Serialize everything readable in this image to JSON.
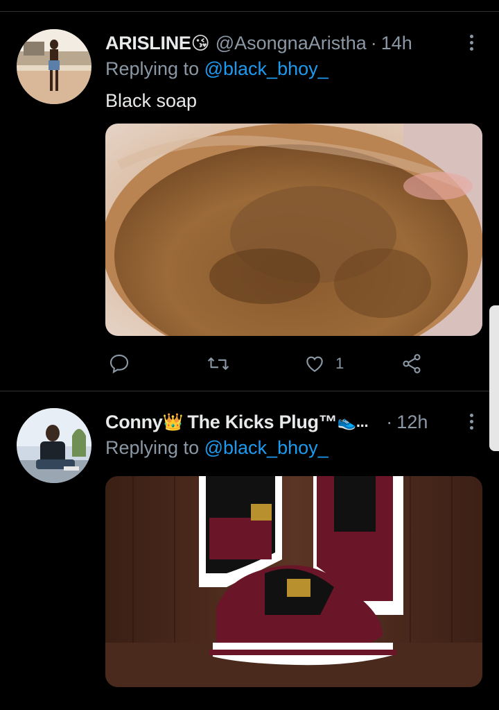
{
  "tweets": [
    {
      "name": "ARISLINE",
      "name_emoji": "😘",
      "handle": "@AsongnaAristha",
      "separator": "·",
      "time": "14h",
      "replying_prefix": "Replying to",
      "replying_handle": "@black_bhoy_",
      "text": "Black soap",
      "media_description": "jar of brown black soap",
      "likes": "1",
      "icons": [
        "reply-icon",
        "retweet-icon",
        "like-icon",
        "share-icon",
        "more-icon"
      ]
    },
    {
      "name": "Conny",
      "name_emoji": "👑",
      "name_suffix": "The Kicks Plug™",
      "name_trailing_emoji": "👟",
      "truncation": "...",
      "separator": "·",
      "time": "12h",
      "replying_prefix": "Replying to",
      "replying_handle": "@black_bhoy_",
      "media_description": "maroon and black sneakers on wooden surface",
      "icons": [
        "more-icon"
      ]
    }
  ],
  "colors": {
    "background": "#000000",
    "link": "#1d9bf0",
    "secondary_text": "#8b98a5",
    "primary_text": "#e7e9ea"
  }
}
